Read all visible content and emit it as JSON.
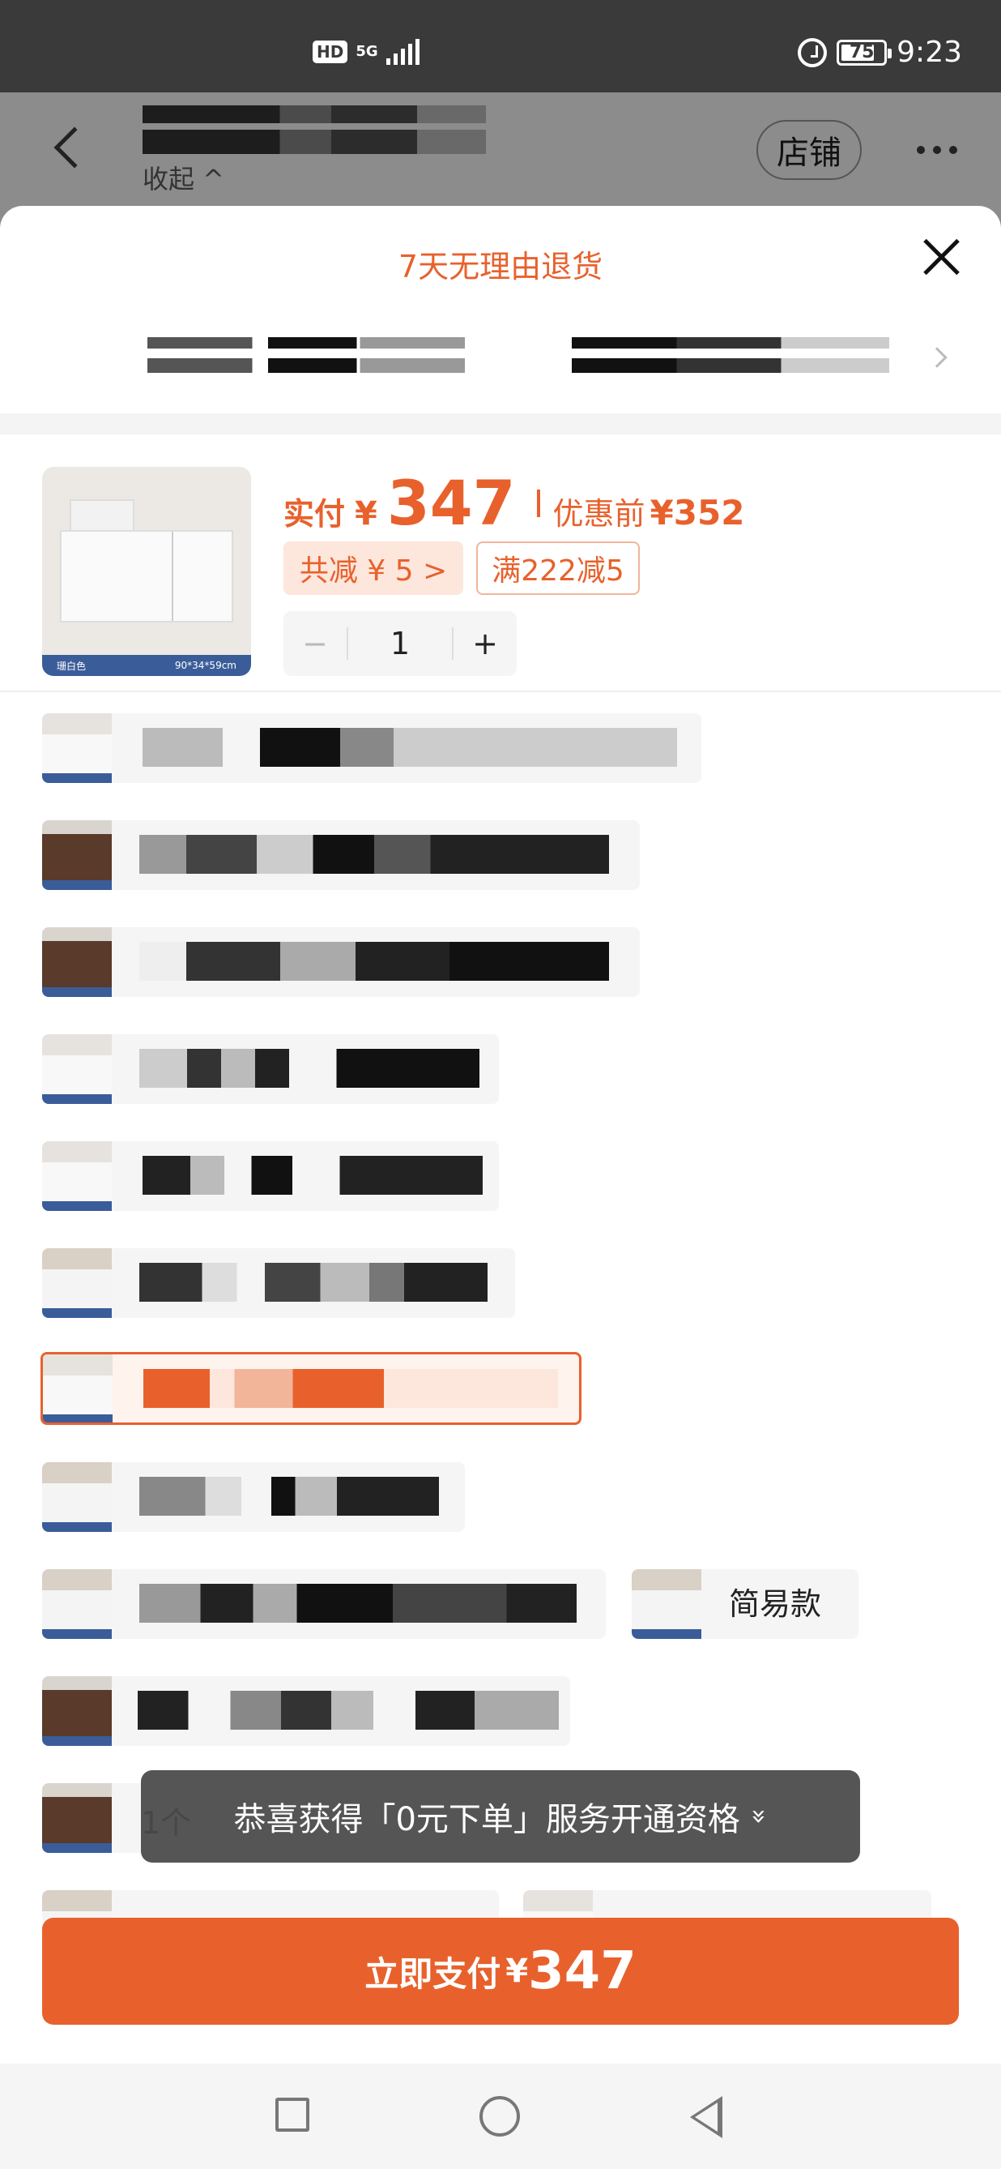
{
  "status_bar": {
    "hd": "HD",
    "network": "5G",
    "battery": "75",
    "time": "9:23",
    "icons": [
      "signal-icon",
      "alarm-icon",
      "battery-icon"
    ]
  },
  "header": {
    "collapse_label": "收起 ^",
    "shop_label": "店铺",
    "icons": [
      "back-icon",
      "more-icon"
    ]
  },
  "sheet": {
    "return_policy": "7天无理由退货",
    "product": {
      "thumb_caption_left": "珊白色",
      "thumb_caption_right": "90*34*59cm",
      "pay_label": "实付",
      "currency": "¥",
      "pay_amount": "347",
      "before_label": "优惠前",
      "before_amount": "¥352",
      "discount_total": "共减 ¥ 5 >",
      "coupon": "满222减5",
      "quantity": "1",
      "qty_minus": "−",
      "qty_plus": "+"
    },
    "variants": {
      "simple_label": "简易款"
    },
    "toast": {
      "partial_text": "1个",
      "message": "恭喜获得「0元下单」服务开通资格",
      "chevron": "»"
    },
    "pay_button": {
      "label": "立即支付",
      "currency": "¥",
      "amount": "347"
    }
  },
  "colors": {
    "accent": "#e8612c",
    "accent_light": "#fde6dc",
    "status_bar": "#3a3a3a"
  }
}
